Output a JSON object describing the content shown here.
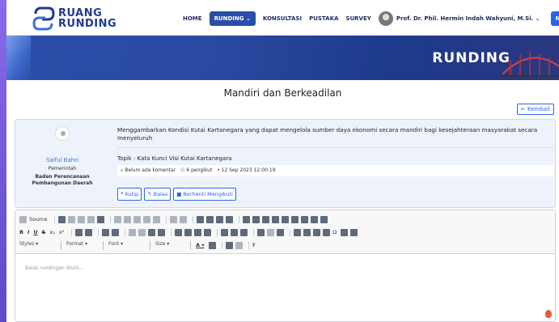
{
  "header": {
    "logo_line1": "RUANG",
    "logo_line2": "RUNDING",
    "nav": [
      {
        "label": "HOME"
      },
      {
        "label": "RUNDING ⌄",
        "active": true
      },
      {
        "label": "KONSULTASI"
      },
      {
        "label": "PUSTAKA"
      },
      {
        "label": "SURVEY"
      }
    ],
    "user": "Prof. Dr. Phil. Hermin Indah Wahyuni, M.Si. ⌄",
    "notif": "Notifikasi"
  },
  "banner": {
    "title": "RUNDING"
  },
  "page": {
    "title": "Mandiri dan Berkeadilan",
    "back": "← Kembali"
  },
  "post": {
    "author": "Saiful Bahri",
    "role": "Pemerintah",
    "org": "Badan Perencanaan Pembangunan Daerah",
    "text": "Menggambarkan Kondisi Kutai Kartanegara yang dapat mengelola sumber daya ekonomi secara mandiri bagi kesejahteraan masyarakat secara menyeluruh",
    "topic": "Topik : Kata Kunci Visi Kutai Kartanegara",
    "meta": {
      "comments": "⌕ Belum ada komentar",
      "followers": "⚇ 6 pengikut",
      "date": "• 12 Sep 2023 12:00:19"
    },
    "actions": {
      "quote": "❝ Kutip",
      "reply": "↰ Balas",
      "unfollow": "■ Berhenti Mengikuti"
    }
  },
  "editor": {
    "source": "Source",
    "styles": "Styles",
    "format": "Format",
    "font": "Font",
    "size": "Size",
    "placeholder": "Balas rundingan disini..."
  },
  "colors": {
    "brand": "#2a4ea8",
    "accent": "#2c63f0",
    "banner": "#1d3a8c"
  }
}
